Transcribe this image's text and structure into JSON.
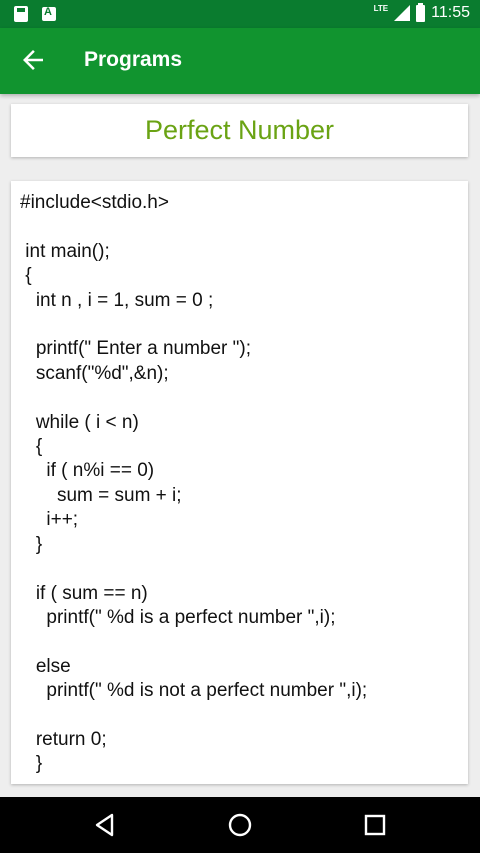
{
  "status_bar": {
    "time": "11:55",
    "network": "LTE",
    "icons": [
      "sd-card-icon",
      "text-a-icon",
      "lte-signal-icon",
      "battery-icon"
    ],
    "color": "#0a7c2f"
  },
  "app_bar": {
    "title": "Programs",
    "back_icon": "arrow-left-icon",
    "color": "#11942f"
  },
  "program": {
    "title": "Perfect Number",
    "title_color": "#6aa314",
    "code": "#include<stdio.h>\n\n int main();\n {\n   int n , i = 1, sum = 0 ;\n\n   printf(\" Enter a number \");\n   scanf(\"%d\",&n);\n\n   while ( i < n)\n   {\n     if ( n%i == 0)\n       sum = sum + i;\n     i++;\n   }\n\n   if ( sum == n)\n     printf(\" %d is a perfect number \",i);\n\n   else\n     printf(\" %d is not a perfect number \",i);\n\n   return 0;\n   }"
  },
  "nav_bar": {
    "icons": [
      "nav-back-icon",
      "nav-home-icon",
      "nav-recents-icon"
    ]
  }
}
